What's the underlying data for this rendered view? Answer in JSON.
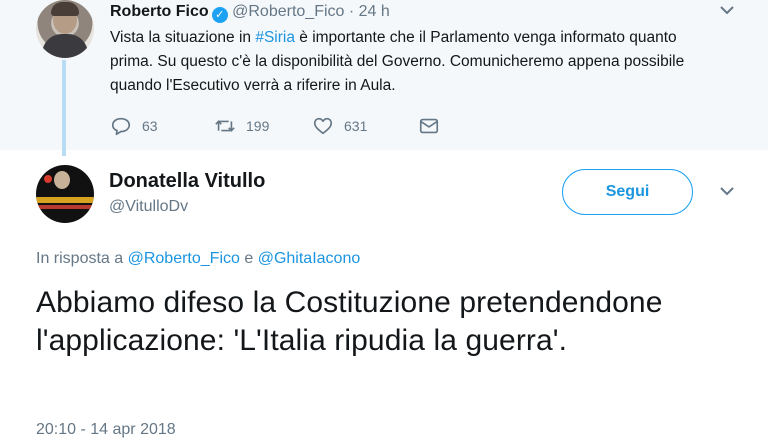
{
  "parent_tweet": {
    "author_name": "Roberto Fico",
    "verified": true,
    "handle": "@Roberto_Fico",
    "separator": "·",
    "time": "24 h",
    "text_before": "Vista la situazione in ",
    "hashtag": "#Siria",
    "text_after": " è importante che il Parlamento venga informato quanto prima. Su questo c'è la disponibilità del Governo. Comunicheremo appena possibile quando l'Esecutivo verrà a riferire in Aula.",
    "reply_count": "63",
    "retweet_count": "199",
    "like_count": "631"
  },
  "main_tweet": {
    "author_name": "Donatella Vitullo",
    "handle": "@VitulloDv",
    "follow_label": "Segui",
    "reply_prefix": "In risposta a",
    "reply_user1": "@Roberto_Fico",
    "reply_conj": "e",
    "reply_user2": "@GhitaIacono",
    "text": "Abbiamo difeso la Costituzione pretendendone l'applicazione: 'L'Italia ripudia la guerra'.",
    "timestamp": "20:10 - 14 apr 2018"
  },
  "icons": {
    "caret": "chevron-down-icon",
    "reply": "reply-icon",
    "retweet": "retweet-icon",
    "like": "heart-icon",
    "dm": "envelope-icon",
    "verified": "verified-badge-icon"
  },
  "colors": {
    "accent": "#1da1f2",
    "link": "#1b95e0",
    "muted": "#657786",
    "thread_line": "#b9dcf5",
    "parent_bg": "#f5f8fa"
  }
}
